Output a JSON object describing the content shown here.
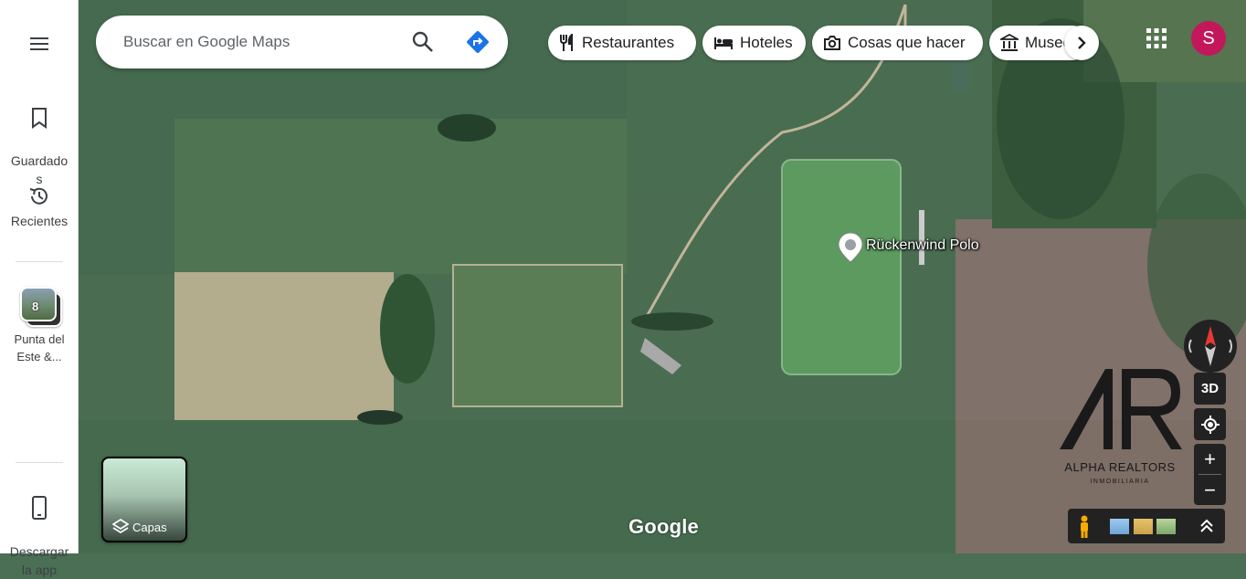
{
  "sidebar": {
    "saved_label": "Guardado\ns",
    "recents_label": "Recientes",
    "recent_place": {
      "count": "8",
      "label": "Punta del\nEste &..."
    },
    "download_label": "Descargar\nla app"
  },
  "search": {
    "placeholder": "Buscar en Google Maps"
  },
  "chips": [
    {
      "label": "Restaurantes",
      "icon": "fork-knife-icon"
    },
    {
      "label": "Hoteles",
      "icon": "bed-icon"
    },
    {
      "label": "Cosas que hacer",
      "icon": "camera-icon"
    },
    {
      "label": "Museo",
      "icon": "museum-icon"
    }
  ],
  "account": {
    "initial": "S",
    "color": "#c2185b"
  },
  "map": {
    "place_label": "Rückenwind Polo",
    "layers_label": "Capas",
    "google_logo": "Google",
    "control_3d": "3D",
    "zoom_in": "+",
    "zoom_out": "−"
  },
  "watermark": {
    "mark": "AR",
    "name": "ALPHA REALTORS",
    "sub": "INMOBILIARIA"
  }
}
